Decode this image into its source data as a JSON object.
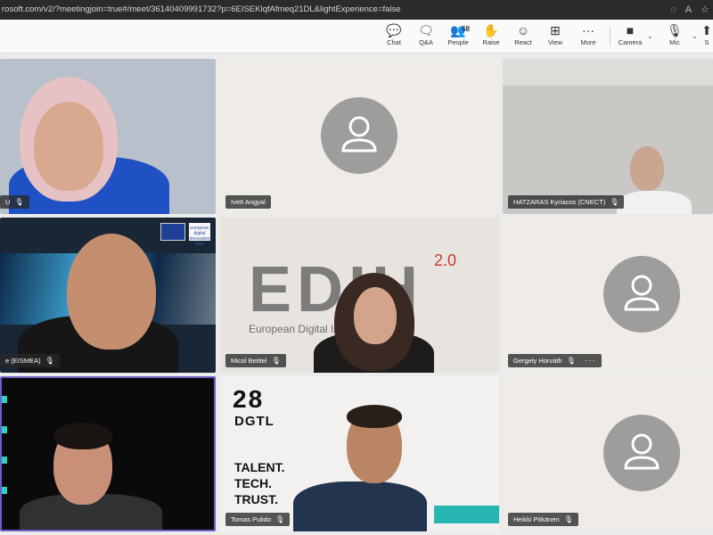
{
  "browser": {
    "url": "rosoft.com/v2/?meetingjoin=true#/meet/36140409991732?p=6EISEKlqfAfmeq21DL&lightExperience=false"
  },
  "toolbar": {
    "items": [
      {
        "label": "Chat",
        "icon": "chat-icon"
      },
      {
        "label": "Q&A",
        "icon": "qa-icon"
      },
      {
        "label": "People",
        "icon": "people-icon",
        "count": "68"
      },
      {
        "label": "Raise",
        "icon": "raise-hand-icon"
      },
      {
        "label": "React",
        "icon": "react-icon"
      },
      {
        "label": "View",
        "icon": "view-icon"
      },
      {
        "label": "More",
        "icon": "more-icon"
      },
      {
        "label": "Camera",
        "icon": "camera-icon"
      },
      {
        "label": "Mic",
        "icon": "mic-icon"
      },
      {
        "label": "S",
        "icon": "share-icon"
      }
    ]
  },
  "participants": [
    {
      "name": "U"
    },
    {
      "name": "Ivett Angyal"
    },
    {
      "name": "HATZARAS Kyriacos (CNECT)"
    },
    {
      "name": "e (EISMEA)"
    },
    {
      "name": "Micol Beittel"
    },
    {
      "name": "Gergely Horváth"
    },
    {
      "name": ""
    },
    {
      "name": "Tomas Pulido"
    },
    {
      "name": "Heikki Pitkänen"
    }
  ],
  "backgrounds": {
    "edih": {
      "logo": "EDIH",
      "version": "2.0",
      "subtitle": "European Digital Inn      d Region"
    },
    "dgtl": {
      "number": "28",
      "brand": "DGTL",
      "lines": [
        "TALENT.",
        "TECH.",
        "TRUST."
      ]
    },
    "eu": {
      "badge": "european digital innovation hubs"
    }
  },
  "colors": {
    "placeholder_bg": "#efece7",
    "avatar": "#9e9d9b",
    "active_border": "#6b5fc7"
  }
}
